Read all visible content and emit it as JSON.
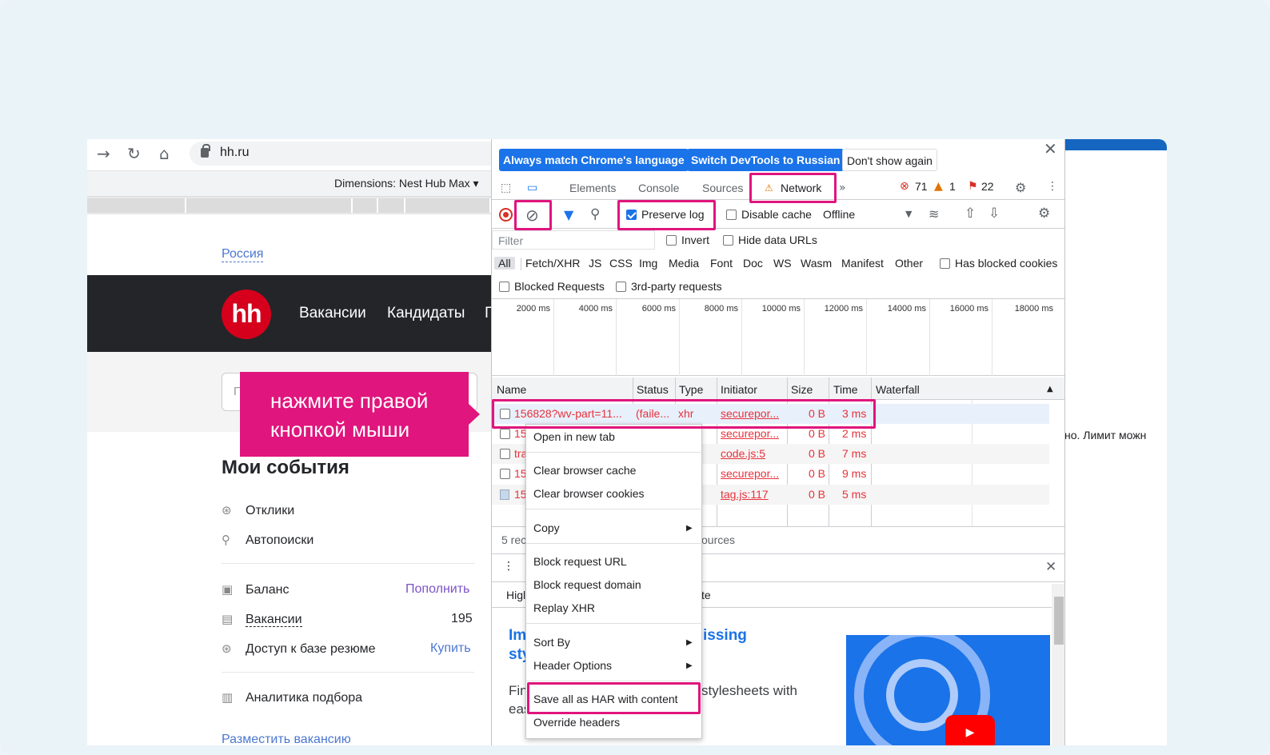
{
  "browser": {
    "url": "hh.ru",
    "dimensions": "Dimensions: Nest Hub Max ▾"
  },
  "site": {
    "region": "Россия",
    "logo": "hh",
    "nav": [
      "Вакансии",
      "Кандидаты",
      "Г"
    ],
    "search_partial": "П",
    "events_title": "Мои события",
    "items": [
      {
        "icon": "responses-icon",
        "label": "Отклики"
      },
      {
        "icon": "autosearch-icon",
        "label": "Автопоиски"
      }
    ],
    "balance": {
      "label": "Баланс",
      "action": "Пополнить"
    },
    "vacancies": {
      "label": "Вакансии",
      "count": "195"
    },
    "access": {
      "label": "Доступ к базе резюме",
      "action": "Купить"
    },
    "analytics": "Аналитика подбора",
    "post": "Разместить вакансию",
    "right_text": "но. Лимит можн",
    "accent": "#7d52c9",
    "link_color": "#4b77d1"
  },
  "devtools": {
    "lang_btn1": "Always match Chrome's language",
    "lang_btn2": "Switch DevTools to Russian",
    "lang_btn3": "Don't show again",
    "tabs": [
      "Elements",
      "Console",
      "Sources",
      "Network"
    ],
    "active_tab": "Network",
    "errors": "71",
    "warnings": "1",
    "issues": "22",
    "preserve_log": "Preserve log",
    "disable_cache": "Disable cache",
    "throttle": "Offline",
    "filter_placeholder": "Filter",
    "invert": "Invert",
    "hide_data": "Hide data URLs",
    "types": [
      "All",
      "Fetch/XHR",
      "JS",
      "CSS",
      "Img",
      "Media",
      "Font",
      "Doc",
      "WS",
      "Wasm",
      "Manifest",
      "Other"
    ],
    "has_blocked": "Has blocked cookies",
    "blocked_req": "Blocked Requests",
    "third_party": "3rd-party requests",
    "timeline": [
      "2000 ms",
      "4000 ms",
      "6000 ms",
      "8000 ms",
      "10000 ms",
      "12000 ms",
      "14000 ms",
      "16000 ms",
      "18000 ms"
    ],
    "columns": [
      "Name",
      "Status",
      "Type",
      "Initiator",
      "Size",
      "Time",
      "Waterfall"
    ],
    "rows": [
      {
        "name": "156828?wv-part=11...",
        "status": "(faile...",
        "type": "xhr",
        "initiator": "securepor...",
        "size": "0 B",
        "time": "3 ms"
      },
      {
        "name": "15",
        "status": "",
        "type": "",
        "initiator": "securepor...",
        "size": "0 B",
        "time": "2 ms"
      },
      {
        "name": "tra",
        "status": "",
        "type": "",
        "initiator": "code.js:5",
        "size": "0 B",
        "time": "7 ms"
      },
      {
        "name": "15",
        "status": "",
        "type": "",
        "initiator": "securepor...",
        "size": "0 B",
        "time": "9 ms"
      },
      {
        "name": "15",
        "status": "",
        "type": "",
        "initiator": "tag.js:117",
        "size": "0 B",
        "time": "5 ms"
      }
    ],
    "status_left": "5 rec",
    "status_right": "ources",
    "drawer_left": "Higl",
    "drawer_right": "te",
    "article_title_a": "Im",
    "article_title_b": "sty",
    "article_title_c": "issing",
    "article_text_a": "Fin",
    "article_text_b": "eas",
    "article_text_c": "stylesheets with"
  },
  "menu": {
    "open_tab": "Open in new tab",
    "clear_cache": "Clear browser cache",
    "clear_cookies": "Clear browser cookies",
    "copy": "Copy",
    "block_url": "Block request URL",
    "block_domain": "Block request domain",
    "replay": "Replay XHR",
    "sort": "Sort By",
    "header_opts": "Header Options",
    "save_har": "Save all as HAR with content",
    "override": "Override headers"
  },
  "callout": {
    "line1": "нажмите правой",
    "line2": "кнопкой мыши"
  },
  "highlight_color": "#e0157d"
}
